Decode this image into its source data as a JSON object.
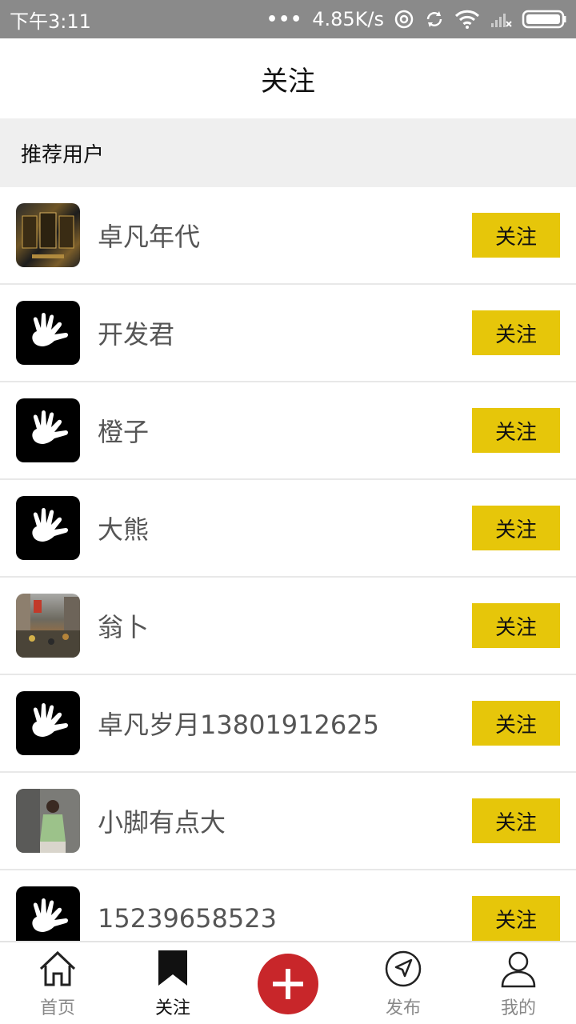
{
  "status_bar": {
    "time": "下午3:11",
    "dots": "•••",
    "speed": "4.85K/s"
  },
  "header": {
    "title": "关注"
  },
  "section": {
    "title": "推荐用户"
  },
  "users": [
    {
      "name": "卓凡年代",
      "avatar": "cards-photo",
      "follow_label": "关注"
    },
    {
      "name": "开发君",
      "avatar": "hand-logo",
      "follow_label": "关注"
    },
    {
      "name": "橙子",
      "avatar": "hand-logo",
      "follow_label": "关注"
    },
    {
      "name": "大熊",
      "avatar": "hand-logo",
      "follow_label": "关注"
    },
    {
      "name": "翁卜",
      "avatar": "street-photo",
      "follow_label": "关注"
    },
    {
      "name": "卓凡岁月13801912625",
      "avatar": "hand-logo",
      "follow_label": "关注"
    },
    {
      "name": "小脚有点大",
      "avatar": "girl-photo",
      "follow_label": "关注"
    },
    {
      "name": "15239658523",
      "avatar": "hand-logo",
      "follow_label": "关注"
    }
  ],
  "bottom_nav": {
    "home": "首页",
    "follow": "关注",
    "publish": "发布",
    "mine": "我的"
  },
  "colors": {
    "status_bar_bg": "#8a8a8a",
    "follow_button": "#e6c60a",
    "publish_button": "#c8262a",
    "section_bg": "#efefef"
  }
}
